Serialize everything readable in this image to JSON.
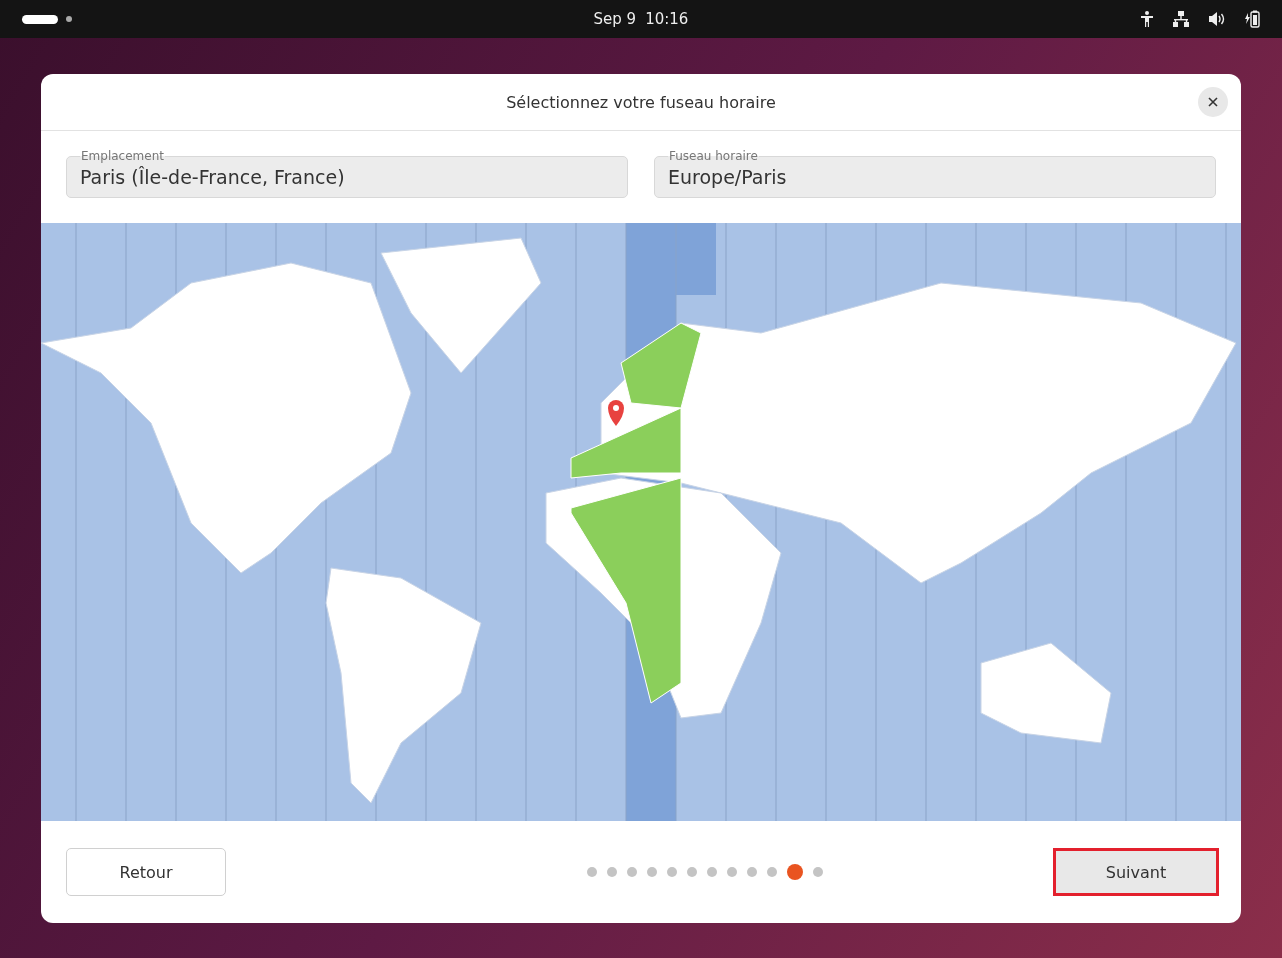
{
  "top_bar": {
    "date": "Sep 9",
    "time": "10:16"
  },
  "dialog": {
    "title": "Sélectionnez votre fuseau horaire",
    "fields": [
      {
        "label": "Emplacement",
        "value": "Paris (Île-de-France, France)"
      },
      {
        "label": "Fuseau horaire",
        "value": "Europe/Paris"
      }
    ],
    "back_button": "Retour",
    "next_button": {
      "label": "Suivant",
      "highlighted": true
    },
    "pages": [
      {
        "selected": false
      },
      {
        "selected": false
      },
      {
        "selected": false
      },
      {
        "selected": false
      },
      {
        "selected": false
      },
      {
        "selected": false
      },
      {
        "selected": false
      },
      {
        "selected": false
      },
      {
        "selected": false
      },
      {
        "selected": false
      },
      {
        "selected": true
      },
      {
        "selected": false
      }
    ]
  }
}
